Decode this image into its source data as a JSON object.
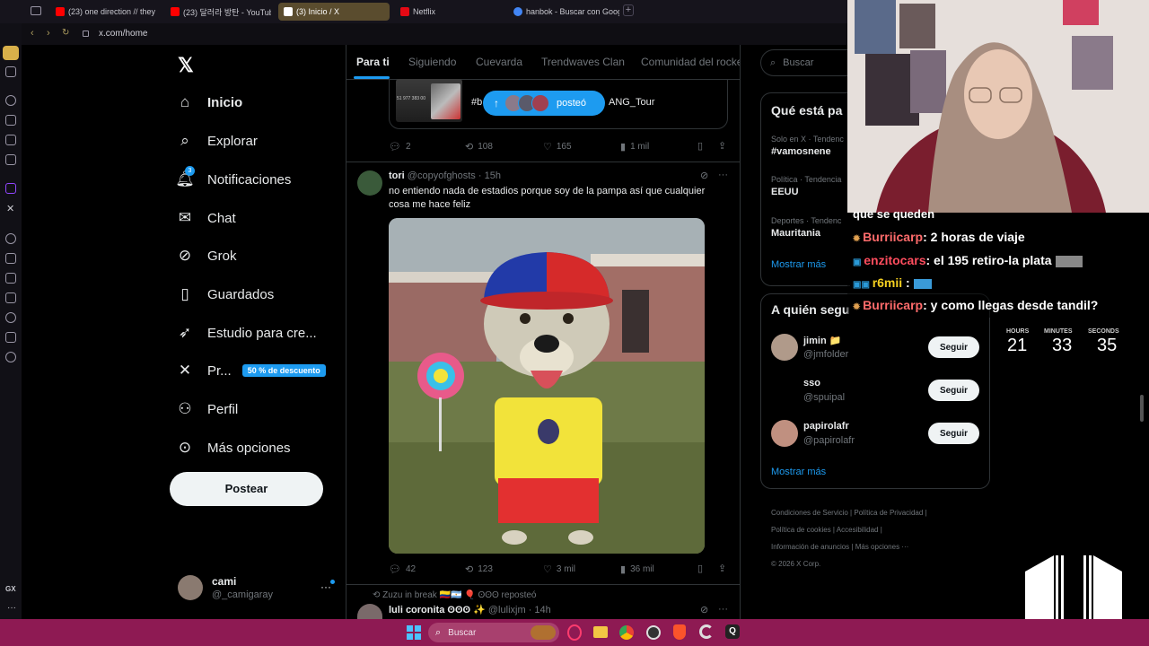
{
  "browser": {
    "tabs": [
      {
        "label": "(23) one direction // they d",
        "favicon_color": "#ff0000"
      },
      {
        "label": "(23) 달러라 방탄 - YouTube",
        "favicon_color": "#ff0000"
      },
      {
        "label": "(3) Inicio / X",
        "favicon_color": "#ffffff"
      },
      {
        "label": "Netflix",
        "favicon_color": "#e50914"
      },
      {
        "label": "hanbok - Buscar con Goog",
        "favicon_color": "#4285f4"
      }
    ],
    "new_tab_label": "+",
    "url": "x.com/home"
  },
  "x": {
    "nav": {
      "home": "Inicio",
      "explore": "Explorar",
      "notifications": "Notificaciones",
      "notifications_badge": "3",
      "chat": "Chat",
      "grok": "Grok",
      "bookmarks": "Guardados",
      "studio": "Estudio para cre...",
      "premium": "Pr...",
      "premium_badge": "50 % de descuento",
      "profile": "Perfil",
      "more": "Más opciones",
      "post_button": "Postear"
    },
    "account": {
      "name": "cami",
      "handle": "@_camigaray"
    },
    "timeline_tabs": [
      "Para ti",
      "Siguiendo",
      "Cuevarda",
      "Trendwaves Clan",
      "Comunidad del rocke"
    ],
    "posted_pill": "posteó",
    "prev_tweet": {
      "text_left": "#b",
      "text_right": "ANG_Tour",
      "thumb_text": "51 977 383 00",
      "replies": "2",
      "retweets": "108",
      "likes": "165",
      "views": "1 mil"
    },
    "tweet": {
      "author": "tori",
      "handle": "@copyofghosts",
      "time": "· 15h",
      "text": "no entiendo nada de estadios porque soy de la pampa así que cualquier cosa me hace feliz",
      "replies": "42",
      "retweets": "123",
      "likes": "3 mil",
      "views": "36 mil"
    },
    "next_tweet": {
      "repost_line": "Zuzu in break 🇨🇴🇦🇷 🎈 ʘʘʘ reposteó",
      "author": "luli coronita ʘʘʘ ✨",
      "handle": "@lulixjm",
      "time": "· 14h"
    },
    "search_placeholder": "Buscar",
    "trends": {
      "title": "Qué está pa",
      "items": [
        {
          "category": "Solo en X · Tendenc",
          "name": "#vamosnene"
        },
        {
          "category": "Política · Tendencia",
          "name": "EEUU"
        },
        {
          "category": "Deportes · Tendenc",
          "name": "Mauritania"
        }
      ],
      "show_more": "Mostrar más"
    },
    "who_to_follow": {
      "title": "A quién segu",
      "users": [
        {
          "name": "jimin 📁",
          "handle": "@jmfolder",
          "button": "Seguir"
        },
        {
          "name": "sso",
          "handle": "@spuipal",
          "button": "Seguir"
        },
        {
          "name": "papirolafr",
          "handle": "@papirolafr",
          "button": "Seguir"
        }
      ],
      "show_more": "Mostrar más"
    },
    "footer": {
      "links": [
        "Condiciones de Servicio",
        "Política de Privacidad",
        "Política de cookies",
        "Accesibilidad",
        "Información de anuncios",
        "Más opciones ···"
      ],
      "copyright": "© 2026 X Corp."
    }
  },
  "stream": {
    "chat_partial": "que se queden",
    "chat": [
      {
        "user": "Burriicarp",
        "message": ": 2 horas de viaje",
        "user_color": "#ff6b6b"
      },
      {
        "user": "enzitocars",
        "message": ": el 195 retiro-la plata",
        "user_color": "#ff4d5e"
      },
      {
        "user": "r6mii",
        "message": ":",
        "user_color": "#f5d020"
      },
      {
        "user": "Burriicarp",
        "message": ": y como llegas desde tandil?",
        "user_color": "#ff6b6b"
      }
    ],
    "countdown": {
      "hours_label": "HOURS",
      "minutes_label": "MINUTES",
      "seconds_label": "SECONDS",
      "hours": "21",
      "minutes": "33",
      "seconds": "35"
    }
  },
  "taskbar": {
    "search_placeholder": "Buscar"
  },
  "colors": {
    "accent": "#1d9bf0",
    "taskbar": "#8e1a53"
  }
}
